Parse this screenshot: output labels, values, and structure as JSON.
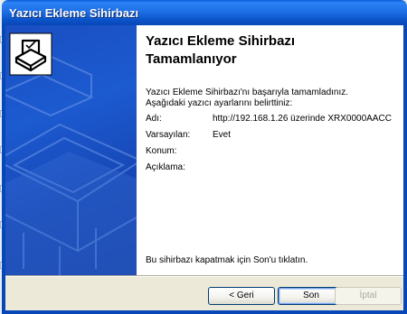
{
  "window": {
    "title": "Yazıcı Ekleme Sihirbazı"
  },
  "page": {
    "heading_line1": "Yazıcı Ekleme Sihirbazı",
    "heading_line2": "Tamamlanıyor",
    "intro_line1": "Yazıcı Ekleme Sihirbazı'nı başarıyla tamamladınız.",
    "intro_line2": "Aşağıdaki yazıcı ayarlarını belirttiniz:",
    "properties": [
      {
        "label": "Adı:",
        "value": "http://192.168.1.26 üzerinde XRX0000AACC"
      },
      {
        "label": "Varsayılan:",
        "value": "Evet"
      },
      {
        "label": "Konum:",
        "value": ""
      },
      {
        "label": "Açıklama:",
        "value": ""
      }
    ],
    "finish_note": "Bu sihirbazı kapatmak için Son'u tıklatın."
  },
  "buttons": {
    "back": "< Geri",
    "finish": "Son",
    "cancel": "İptal"
  },
  "colors": {
    "titlebar": "#0a52c8",
    "side_panel": "#1a4fc2",
    "button_border": "#003c74"
  },
  "icons": {
    "wizard_icon": "printer-check-icon"
  }
}
